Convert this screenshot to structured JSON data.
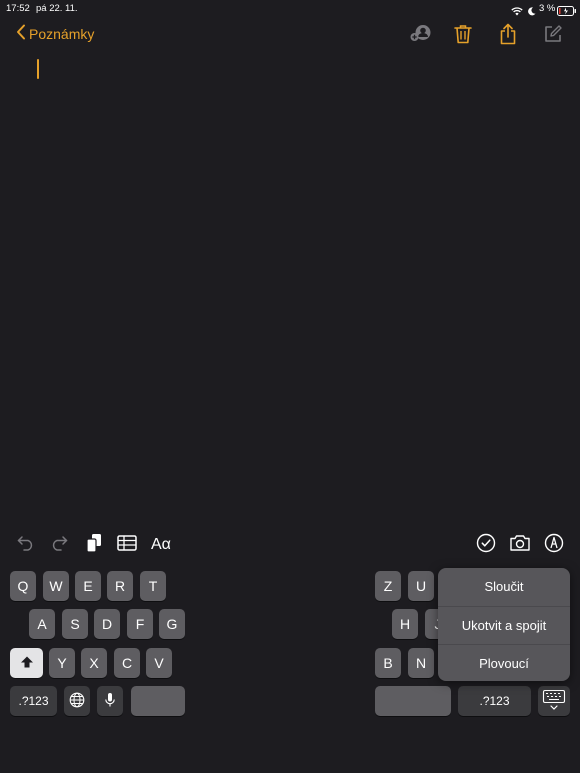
{
  "status_bar": {
    "time": "17:52",
    "date": "pá 22. 11.",
    "battery": "3 %"
  },
  "nav": {
    "back_label": "Poznámky"
  },
  "keyboard": {
    "left_row1": [
      "Q",
      "W",
      "E",
      "R",
      "T"
    ],
    "left_row2": [
      "A",
      "S",
      "D",
      "F",
      "G"
    ],
    "left_row3": [
      "Y",
      "X",
      "C",
      "V"
    ],
    "numbers_key": ".?123",
    "right_row1": [
      "Z",
      "U"
    ],
    "right_row2": [
      "H",
      "J"
    ],
    "right_row3": [
      "B",
      "N"
    ],
    "right_numbers_key": ".?123"
  },
  "keyboard_menu": {
    "items": [
      "Sloučit",
      "Ukotvit a spojit",
      "Plovoucí"
    ]
  },
  "colors": {
    "accent": "#e6a12a",
    "background": "#1d1c20",
    "key": "#5e5d61"
  }
}
